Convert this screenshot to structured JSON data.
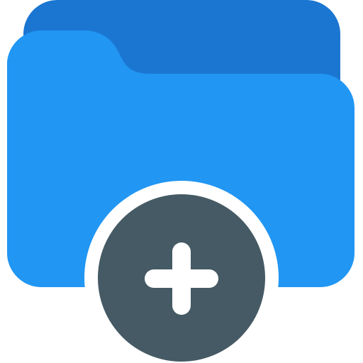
{
  "icon": {
    "name": "add-folder-icon",
    "parts": {
      "folder": "folder-icon",
      "badge": "plus-circle-icon",
      "glyph": "plus-icon"
    }
  },
  "colors": {
    "folder_back": "#1B76D2",
    "folder_front": "#2196F3",
    "badge_fill": "#455A64",
    "badge_ring": "#FFFFFF",
    "plus": "#FFFFFF",
    "background": "#FFFFFF"
  }
}
